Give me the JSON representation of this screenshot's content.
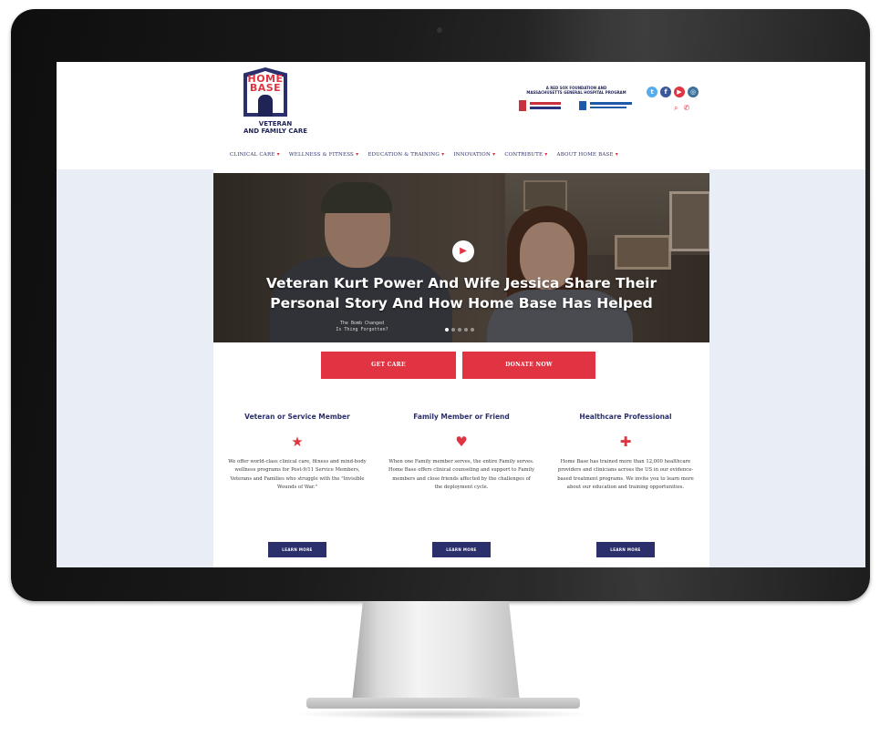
{
  "logo": {
    "home_line": "HOME",
    "base_line": "BASE",
    "tagline_1": "VETERAN",
    "tagline_2": "AND FAMILY CARE"
  },
  "partner": {
    "line_1": "A RED SOX FOUNDATION AND",
    "line_2": "MASSACHUSETTS GENERAL HOSPITAL PROGRAM"
  },
  "social": [
    {
      "icon": "twitter-icon",
      "glyph": "t",
      "color": "#55acee"
    },
    {
      "icon": "facebook-icon",
      "glyph": "f",
      "color": "#3b5998"
    },
    {
      "icon": "youtube-icon",
      "glyph": "▶",
      "color": "#e03442"
    },
    {
      "icon": "instagram-icon",
      "glyph": "◎",
      "color": "#3f729b"
    }
  ],
  "tools": {
    "search_icon": "search-icon",
    "phone_icon": "phone-icon"
  },
  "nav": {
    "items": [
      "CLINICAL CARE",
      "WELLNESS & FITNESS",
      "EDUCATION & TRAINING",
      "INNOVATION",
      "CONTRIBUTE",
      "ABOUT HOME BASE"
    ]
  },
  "hero": {
    "title_line_1": "Veteran Kurt Power And Wife Jessica Share Their",
    "title_line_2": "Personal Story And How Home Base Has Helped",
    "shirt_line_1": "The Bomb Changed",
    "shirt_line_2": "Is Thing Forgotten?",
    "slides": 5,
    "active_slide": 1
  },
  "cta": {
    "get_care": "GET CARE",
    "donate": "DONATE NOW"
  },
  "cards": [
    {
      "title": "Veteran or Service Member",
      "icon": "star-icon",
      "glyph": "★",
      "text": "We offer world-class clinical care, fitness and mind-body wellness programs for Post-9/11 Service Members, Veterans and Families who struggle with the \"Invisible Wounds of War.\"",
      "button": "LEARN MORE"
    },
    {
      "title": "Family Member or Friend",
      "icon": "heart-icon",
      "glyph": "♥",
      "text": "When one Family member serves, the entire Family serves. Home Base offers clinical counseling and support to Family members and close friends affected by the challenges of the deployment cycle.",
      "button": "LEARN MORE"
    },
    {
      "title": "Healthcare Professional",
      "icon": "plus-icon",
      "glyph": "✚",
      "text": "Home Base has trained more than 12,000 healthcare providers and clinicians across the US in our evidence-based treatment programs. We invite you to learn more about our education and training opportunities.",
      "button": "LEARN MORE"
    }
  ],
  "colors": {
    "accent_red": "#e03442",
    "navy": "#2b2f6b",
    "page_bg": "#e9eef6"
  }
}
